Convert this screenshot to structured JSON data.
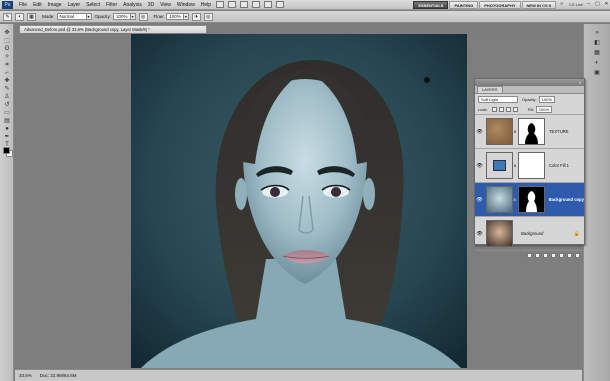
{
  "menu": {
    "logo": "Ps",
    "items": [
      "File",
      "Edit",
      "Image",
      "Layer",
      "Select",
      "Filter",
      "Analysis",
      "3D",
      "View",
      "Window",
      "Help"
    ],
    "workspaces": [
      "ESSENTIALS",
      "PAINTING",
      "PHOTOGRAPHY",
      "NEW IN CS 5"
    ],
    "more": "»",
    "cslive": "CS Live",
    "window_buttons": [
      "–",
      "▢",
      "✕"
    ]
  },
  "options": {
    "mode_label": "Mode:",
    "mode_value": "Normal",
    "opacity_label": "Opacity:",
    "opacity_value": "100%",
    "flow_label": "Flow:",
    "flow_value": "100%"
  },
  "document": {
    "tab_title": "Advanced_Before.psd @ 33,6% (Background copy, Layer Mask/8) *",
    "zoom": "33,6%",
    "doc_info": "Doc: 22.9M/84.6M"
  },
  "layers_panel": {
    "tab_label": "LAYERS",
    "collapse": "«",
    "blend_mode": "Soft Light",
    "opacity_label": "Opacity:",
    "opacity_value": "100%",
    "lock_label": "Lock:",
    "fill_label": "Fill:",
    "fill_value": "100%",
    "layers": [
      {
        "name": "TEXTURE",
        "selected": false,
        "italic": false
      },
      {
        "name": "Color Fill 1",
        "selected": false,
        "italic": false
      },
      {
        "name": "Background copy",
        "selected": true,
        "italic": false
      },
      {
        "name": "Background",
        "selected": false,
        "italic": true,
        "lock": "🔒"
      }
    ],
    "eye": "👁",
    "chain": "8"
  },
  "colors": {
    "selected_layer": "#2f5bad",
    "active_workspace": "#444444",
    "photo_background": "#1f3c4a"
  }
}
